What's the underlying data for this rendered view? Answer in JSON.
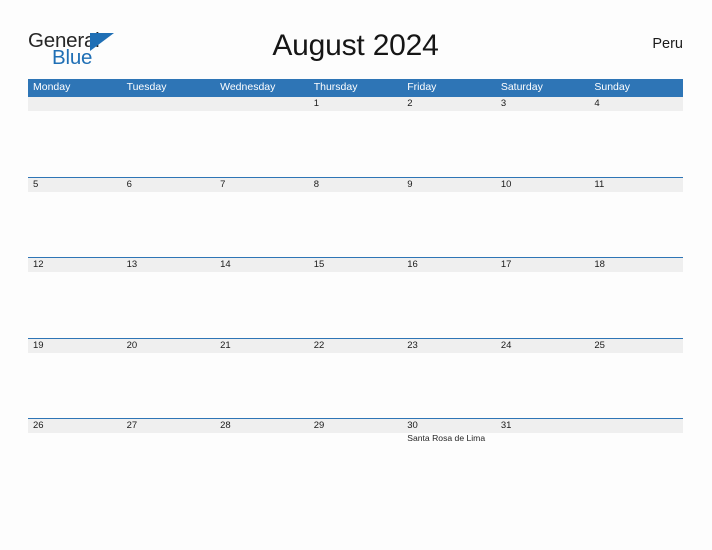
{
  "brand": {
    "name_part1": "General",
    "name_part2": "Blue",
    "triangle_icon": "triangle-icon",
    "color_primary": "#1f6fb5",
    "color_text": "#262626"
  },
  "header": {
    "title": "August 2024",
    "country": "Peru",
    "header_bg_color": "#2e75b6",
    "band_bg_color": "#efefef"
  },
  "calendar": {
    "weekdays": [
      "Monday",
      "Tuesday",
      "Wednesday",
      "Thursday",
      "Friday",
      "Saturday",
      "Sunday"
    ],
    "weeks": [
      {
        "days": [
          {
            "num": "",
            "event": ""
          },
          {
            "num": "",
            "event": ""
          },
          {
            "num": "",
            "event": ""
          },
          {
            "num": "1",
            "event": ""
          },
          {
            "num": "2",
            "event": ""
          },
          {
            "num": "3",
            "event": ""
          },
          {
            "num": "4",
            "event": ""
          }
        ]
      },
      {
        "days": [
          {
            "num": "5",
            "event": ""
          },
          {
            "num": "6",
            "event": ""
          },
          {
            "num": "7",
            "event": ""
          },
          {
            "num": "8",
            "event": ""
          },
          {
            "num": "9",
            "event": ""
          },
          {
            "num": "10",
            "event": ""
          },
          {
            "num": "11",
            "event": ""
          }
        ]
      },
      {
        "days": [
          {
            "num": "12",
            "event": ""
          },
          {
            "num": "13",
            "event": ""
          },
          {
            "num": "14",
            "event": ""
          },
          {
            "num": "15",
            "event": ""
          },
          {
            "num": "16",
            "event": ""
          },
          {
            "num": "17",
            "event": ""
          },
          {
            "num": "18",
            "event": ""
          }
        ]
      },
      {
        "days": [
          {
            "num": "19",
            "event": ""
          },
          {
            "num": "20",
            "event": ""
          },
          {
            "num": "21",
            "event": ""
          },
          {
            "num": "22",
            "event": ""
          },
          {
            "num": "23",
            "event": ""
          },
          {
            "num": "24",
            "event": ""
          },
          {
            "num": "25",
            "event": ""
          }
        ]
      },
      {
        "days": [
          {
            "num": "26",
            "event": ""
          },
          {
            "num": "27",
            "event": ""
          },
          {
            "num": "28",
            "event": ""
          },
          {
            "num": "29",
            "event": ""
          },
          {
            "num": "30",
            "event": "Santa Rosa de Lima"
          },
          {
            "num": "31",
            "event": ""
          },
          {
            "num": "",
            "event": ""
          }
        ]
      }
    ]
  }
}
